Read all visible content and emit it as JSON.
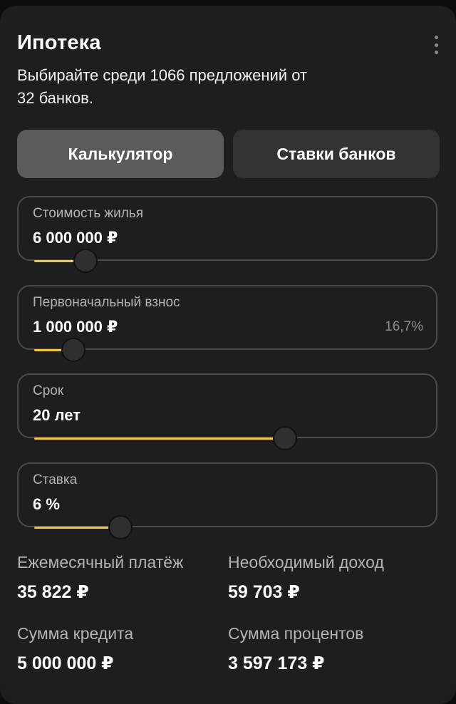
{
  "header": {
    "title": "Ипотека",
    "subtitle_line1": "Выбирайте среди 1066 предложений от",
    "subtitle_line2": "32 банков."
  },
  "tabs": [
    {
      "label": "Калькулятор",
      "active": true
    },
    {
      "label": "Ставки банков",
      "active": false
    }
  ],
  "fields": {
    "price": {
      "label": "Стоимость жилья",
      "value": "6 000 000 ₽",
      "slider_fraction": 0.13
    },
    "down_payment": {
      "label": "Первоначальный взнос",
      "value": "1 000 000 ₽",
      "extra": "16,7%",
      "slider_fraction": 0.1
    },
    "term": {
      "label": "Срок",
      "value": "20 лет",
      "slider_fraction": 0.64
    },
    "rate": {
      "label": "Ставка",
      "value": "6 %",
      "slider_fraction": 0.22
    }
  },
  "results": {
    "monthly_payment": {
      "label": "Ежемесячный платёж",
      "value": "35 822 ₽"
    },
    "required_income": {
      "label": "Необходимый доход",
      "value": "59 703 ₽"
    },
    "loan_amount": {
      "label": "Сумма кредита",
      "value": "5 000 000 ₽"
    },
    "interest_total": {
      "label": "Сумма процентов",
      "value": "3 597 173 ₽"
    }
  },
  "colors": {
    "accent": "#f2c63d",
    "card": "#1e1e1e",
    "tab_active": "#5a5a5a",
    "tab_inactive": "#333333"
  },
  "icons": {
    "menu": "more-vertical-icon"
  }
}
